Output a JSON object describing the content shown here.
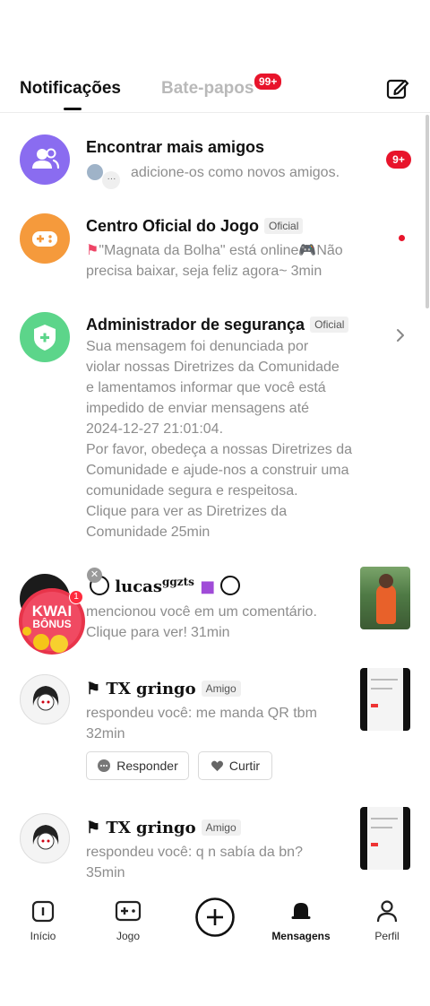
{
  "header": {
    "tab_notifications": "Notificações",
    "tab_chats": "Bate-papos",
    "chats_badge": "99+"
  },
  "notifications": [
    {
      "title": "Encontrar mais amigos",
      "body": "adicione-os como novos amigos.",
      "badge": "9+",
      "icon": "people-icon",
      "color": "#8a6cf0"
    },
    {
      "title": "Centro Oficial do Jogo",
      "tag": "Oficial",
      "body_line1": "\"Magnata da Bolha\" está online🎮Não",
      "body_line2": "precisa baixar, seja feliz agora~",
      "time": "3min",
      "icon": "gamepad-icon",
      "color": "#f59a3c"
    },
    {
      "title": "Administrador de segurança",
      "tag": "Oficial",
      "lines": [
        "Sua mensagem foi denunciada por",
        "violar nossas Diretrizes da Comunidade",
        "e lamentamos informar que você está",
        "impedido de enviar mensagens até",
        "2024-12-27 21:01:04.",
        "Por favor, obedeça a nossas Diretrizes da",
        "Comunidade e ajude-nos a construir uma",
        "comunidade segura e respeitosa.",
        "Clique para ver as Diretrizes da",
        "Comunidade"
      ],
      "time": "25min",
      "icon": "shield-plus-icon",
      "color": "#5cd58a"
    },
    {
      "title": "lucas",
      "title_sup": "ggzts",
      "body_line1": "mencionou você em um comentário.",
      "body_line2": "Clique para ver!",
      "time": "31min",
      "kwai_label": "KWAI",
      "kwai_sub": "BÔNUS",
      "kwai_badge": "1"
    },
    {
      "title": "TX gringo",
      "tag": "Amigo",
      "body": "respondeu você: me manda QR tbm",
      "time": "32min",
      "reply_label": "Responder",
      "like_label": "Curtir"
    },
    {
      "title": "TX gringo",
      "tag": "Amigo",
      "body": "respondeu você: q n sabía da bn?",
      "time": "35min"
    }
  ],
  "nav": {
    "home": "Início",
    "game": "Jogo",
    "messages": "Mensagens",
    "profile": "Perfil"
  }
}
